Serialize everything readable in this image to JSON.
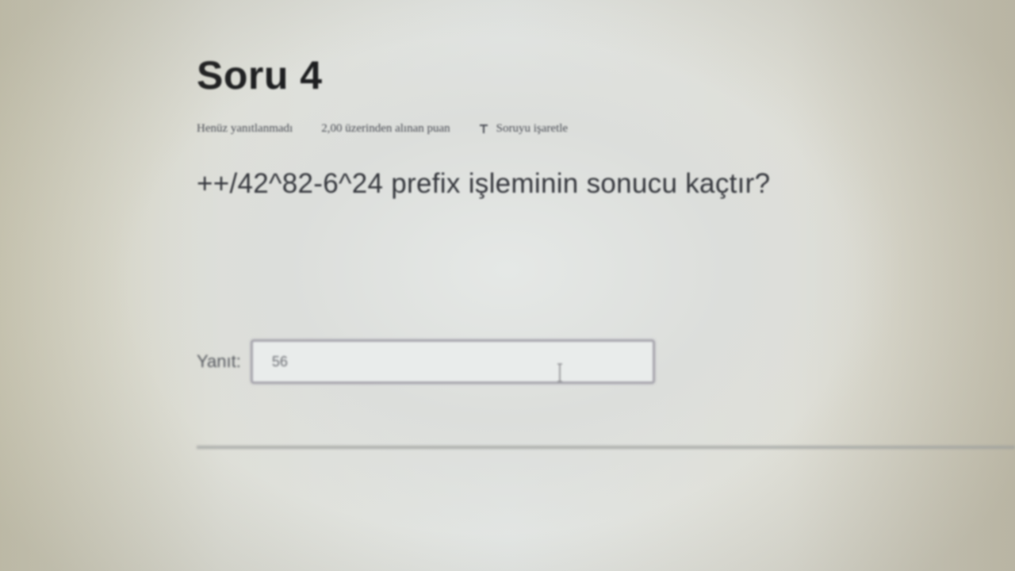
{
  "question": {
    "title": "Soru 4",
    "status": "Henüz yanıtlanmadı",
    "grade_info": "2,00 üzerinden alınan puan",
    "flag_label": "Soruyu işaretle",
    "text": "++/42^82-6^24 prefix işleminin sonucu kaçtır?"
  },
  "answer": {
    "label": "Yanıt:",
    "value": "56"
  },
  "icons": {
    "flag": "flag-icon",
    "cursor": "text-cursor-icon"
  }
}
